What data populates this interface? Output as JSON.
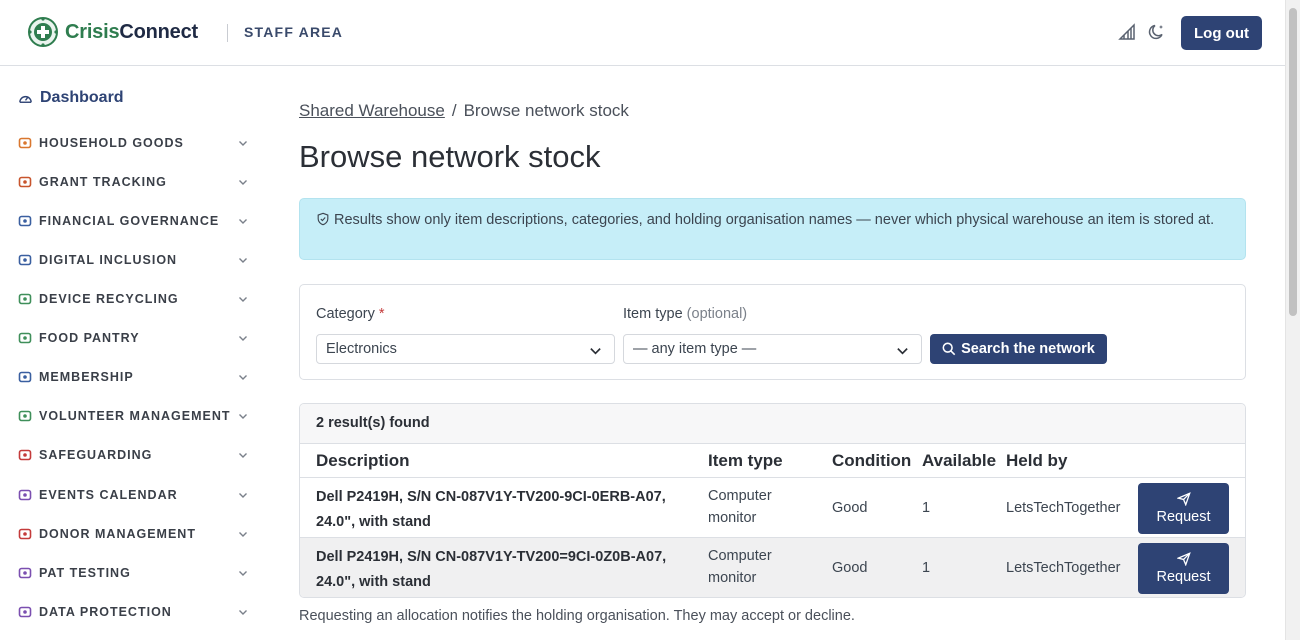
{
  "header": {
    "brand_part1": "Crisis",
    "brand_part2": "Connect",
    "area_label": "STAFF AREA",
    "logout_label": "Log out",
    "icons": [
      "signal-icon",
      "moon-icon"
    ]
  },
  "sidebar": {
    "dashboard_label": "Dashboard",
    "items": [
      {
        "label": "HOUSEHOLD GOODS",
        "icon": "house-icon",
        "color": "#d9772f"
      },
      {
        "label": "GRANT TRACKING",
        "icon": "wallet-icon",
        "color": "#c8552d"
      },
      {
        "label": "FINANCIAL GOVERNANCE",
        "icon": "bank-icon",
        "color": "#3a5fa0"
      },
      {
        "label": "DIGITAL INCLUSION",
        "icon": "laptop-icon",
        "color": "#3a5fa0"
      },
      {
        "label": "DEVICE RECYCLING",
        "icon": "recycle-icon",
        "color": "#3f8f5a"
      },
      {
        "label": "FOOD PANTRY",
        "icon": "basket-icon",
        "color": "#3f8f5a"
      },
      {
        "label": "MEMBERSHIP",
        "icon": "id-card-icon",
        "color": "#3a5fa0"
      },
      {
        "label": "VOLUNTEER MANAGEMENT",
        "icon": "badge-icon",
        "color": "#3f8f5a"
      },
      {
        "label": "SAFEGUARDING",
        "icon": "shield-icon",
        "color": "#c43b3b"
      },
      {
        "label": "EVENTS CALENDAR",
        "icon": "calendar-icon",
        "color": "#7b4fb0"
      },
      {
        "label": "DONOR MANAGEMENT",
        "icon": "heart-icon",
        "color": "#c43b3b"
      },
      {
        "label": "PAT TESTING",
        "icon": "plug-icon",
        "color": "#7b4fb0"
      },
      {
        "label": "DATA PROTECTION",
        "icon": "document-lock-icon",
        "color": "#7b4fb0"
      }
    ]
  },
  "main": {
    "breadcrumb": {
      "link": "Shared Warehouse",
      "separator": "/",
      "current": "Browse network stock"
    },
    "title": "Browse network stock",
    "alert": "Results show only item descriptions, categories, and holding organisation names — never which physical warehouse an item is stored at.",
    "form": {
      "category_label": "Category",
      "required_mark": "*",
      "category_value": "Electronics",
      "item_type_label": "Item type",
      "item_type_optional": "(optional)",
      "item_type_value": "— any item type —",
      "search_label": "Search the network"
    },
    "results": {
      "count_label": "2 result(s) found",
      "columns": [
        "Description",
        "Item type",
        "Condition",
        "Available",
        "Held by"
      ],
      "rows": [
        {
          "description": "Dell P2419H, S/N CN-087V1Y-TV200-9CI-0ERB-A07, 24.0\", with stand",
          "item_type": "Computer monitor",
          "condition": "Good",
          "available": "1",
          "held_by": "LetsTechTogether",
          "action": "Request"
        },
        {
          "description": "Dell P2419H, S/N CN-087V1Y-TV200=9CI-0Z0B-A07, 24.0\", with stand",
          "item_type": "Computer monitor",
          "condition": "Good",
          "available": "1",
          "held_by": "LetsTechTogether",
          "action": "Request"
        }
      ]
    },
    "footnote": "Requesting an allocation notifies the holding organisation. They may accept or decline."
  }
}
